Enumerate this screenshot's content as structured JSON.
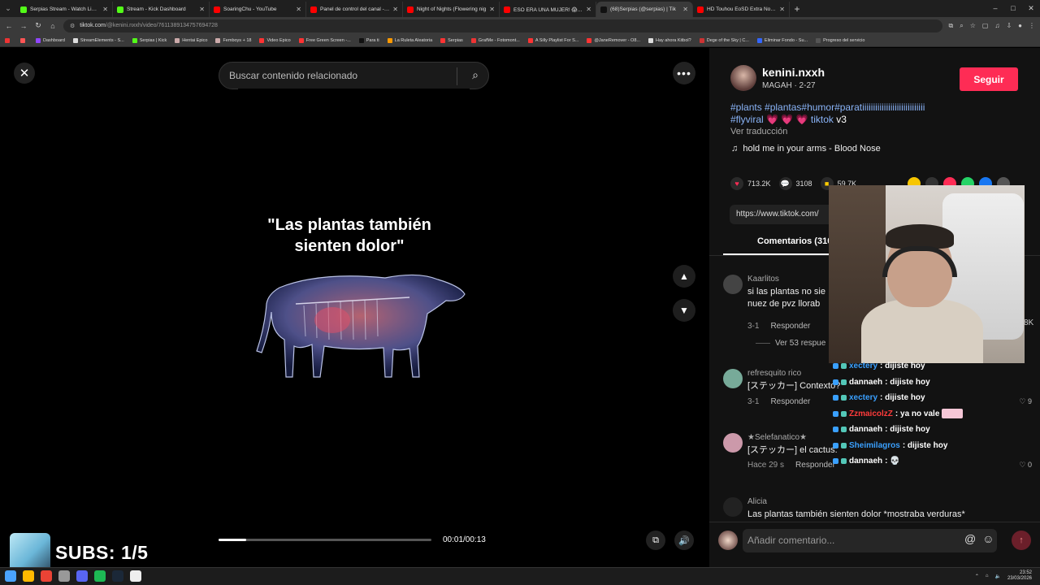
{
  "browser": {
    "tabs": [
      {
        "title": "Serpias Stream - Watch Live on",
        "color": "#53fc18"
      },
      {
        "title": "Stream - Kick Dashboard",
        "color": "#53fc18"
      },
      {
        "title": "SoaringChu - YouTube",
        "color": "#ff0000"
      },
      {
        "title": "Panel de control del canal - You",
        "color": "#ff0000"
      },
      {
        "title": "Night of Nights (Flowering nig",
        "color": "#ff0000"
      },
      {
        "title": "ESO ERA UNA MUJER! 😱 #m",
        "color": "#ff0000"
      },
      {
        "title": "(68)Serpias (@serpias) | Tik",
        "color": "#111111",
        "active": true
      },
      {
        "title": "HD Touhou EoSD Extra No Dea",
        "color": "#ff0000"
      }
    ],
    "url_host": "tiktok.com",
    "url_path": "/@kenini.nxxh/video/7611389134757694728",
    "bookmarks": [
      {
        "label": "",
        "color": "#e33"
      },
      {
        "label": "",
        "color": "#f55"
      },
      {
        "label": "Dashboard",
        "color": "#9146ff"
      },
      {
        "label": "StreamElements - S...",
        "color": "#ddd"
      },
      {
        "label": "Serpias | Kick",
        "color": "#53fc18"
      },
      {
        "label": "Hentai Epico",
        "color": "#caa"
      },
      {
        "label": "Femboys + 18",
        "color": "#caa"
      },
      {
        "label": "Video Epico",
        "color": "#f33"
      },
      {
        "label": "Free Green Screen -...",
        "color": "#f33"
      },
      {
        "label": "Para ti",
        "color": "#111"
      },
      {
        "label": "La Ruleta Aleatoria",
        "color": "#f90"
      },
      {
        "label": "Serpias",
        "color": "#f33"
      },
      {
        "label": "GrafMe - Fotomont...",
        "color": "#e33"
      },
      {
        "label": "A Silly Playlist For S...",
        "color": "#f33"
      },
      {
        "label": "@JaneRemover - O8...",
        "color": "#f33"
      },
      {
        "label": "Hay ahora Kitbol?",
        "color": "#ddd"
      },
      {
        "label": "Dege of the Sky | C...",
        "color": "#c33"
      },
      {
        "label": "Eliminar Fondo - Su...",
        "color": "#36f"
      },
      {
        "label": "Progreso del servicio",
        "color": "#555"
      }
    ]
  },
  "player": {
    "search_placeholder": "Buscar contenido relacionado",
    "caption": "\"Las plantas también sienten dolor\"",
    "time": "00:01/00:13",
    "progress": 0.13,
    "close_icon": "close-icon",
    "more_icon": "more-icon"
  },
  "overlay": {
    "subs": "SUBS: 1/5"
  },
  "post": {
    "author": "kenini.nxxh",
    "meta": "MAGAH · 2-27",
    "follow": "Seguir",
    "tags_line1": "#plants #plantas#humor#paratiiiiiiiiiiiiiiiiiiiiiiiiiiiii",
    "tags_line2a": "#flyviral",
    "tags_line2b": "💗 💗 💗",
    "tags_line2c": "tiktok",
    "tags_line2d": "v3",
    "translate": "Ver traducción",
    "music": "hold me in your arms - Blood Nose",
    "likes": "713.2K",
    "comments": "3108",
    "saves": "59.7K",
    "link": "https://www.tiktok.com/",
    "comments_tab": "Comentarios (310"
  },
  "comments": [
    {
      "user": "Kaarlitos",
      "text": "si las plantas no sie\nnuez de pvz llorab",
      "date": "3-1",
      "reply": "Responder",
      "likes": "8K",
      "avatar": "#444"
    },
    {
      "user": "refresquito rico",
      "text": "[ステッカー] Contexto?",
      "date": "3-1",
      "reply": "Responder",
      "likes": "9",
      "avatar": "#7a9"
    },
    {
      "user": "★Selefanatico★",
      "text": "[ステッカー] el cactus:",
      "date": "Hace 29 s",
      "reply": "Responder",
      "likes": "0",
      "avatar": "#c9a"
    },
    {
      "user": "Alicia",
      "text": "Las plantas también sienten dolor *mostraba verduras*",
      "date": "",
      "reply": "",
      "likes": "",
      "avatar": "#222"
    }
  ],
  "replies_label": "Ver 53 respue",
  "add_comment_placeholder": "Añadir comentario...",
  "webcam_side_number": "8K",
  "chat": [
    {
      "user": "xectery",
      "color": "#3aa0ff",
      "msg": ": dijiste hoy"
    },
    {
      "user": "dannaeh",
      "color": "#ffffff",
      "msg": ": dijiste hoy"
    },
    {
      "user": "xectery",
      "color": "#3aa0ff",
      "msg": ": dijiste hoy"
    },
    {
      "user": "ZzmaicolzZ",
      "color": "#ff3b3b",
      "msg": ": ya no vale"
    },
    {
      "user": "dannaeh",
      "color": "#ffffff",
      "msg": ": dijiste hoy"
    },
    {
      "user": "Sheimilagros",
      "color": "#3aa0ff",
      "msg": ": dijiste hoy"
    },
    {
      "user": "dannaeh",
      "color": "#ffffff",
      "msg": ": 💀"
    }
  ],
  "taskbar": {
    "time": "23:52",
    "date": "23/03/2026"
  }
}
